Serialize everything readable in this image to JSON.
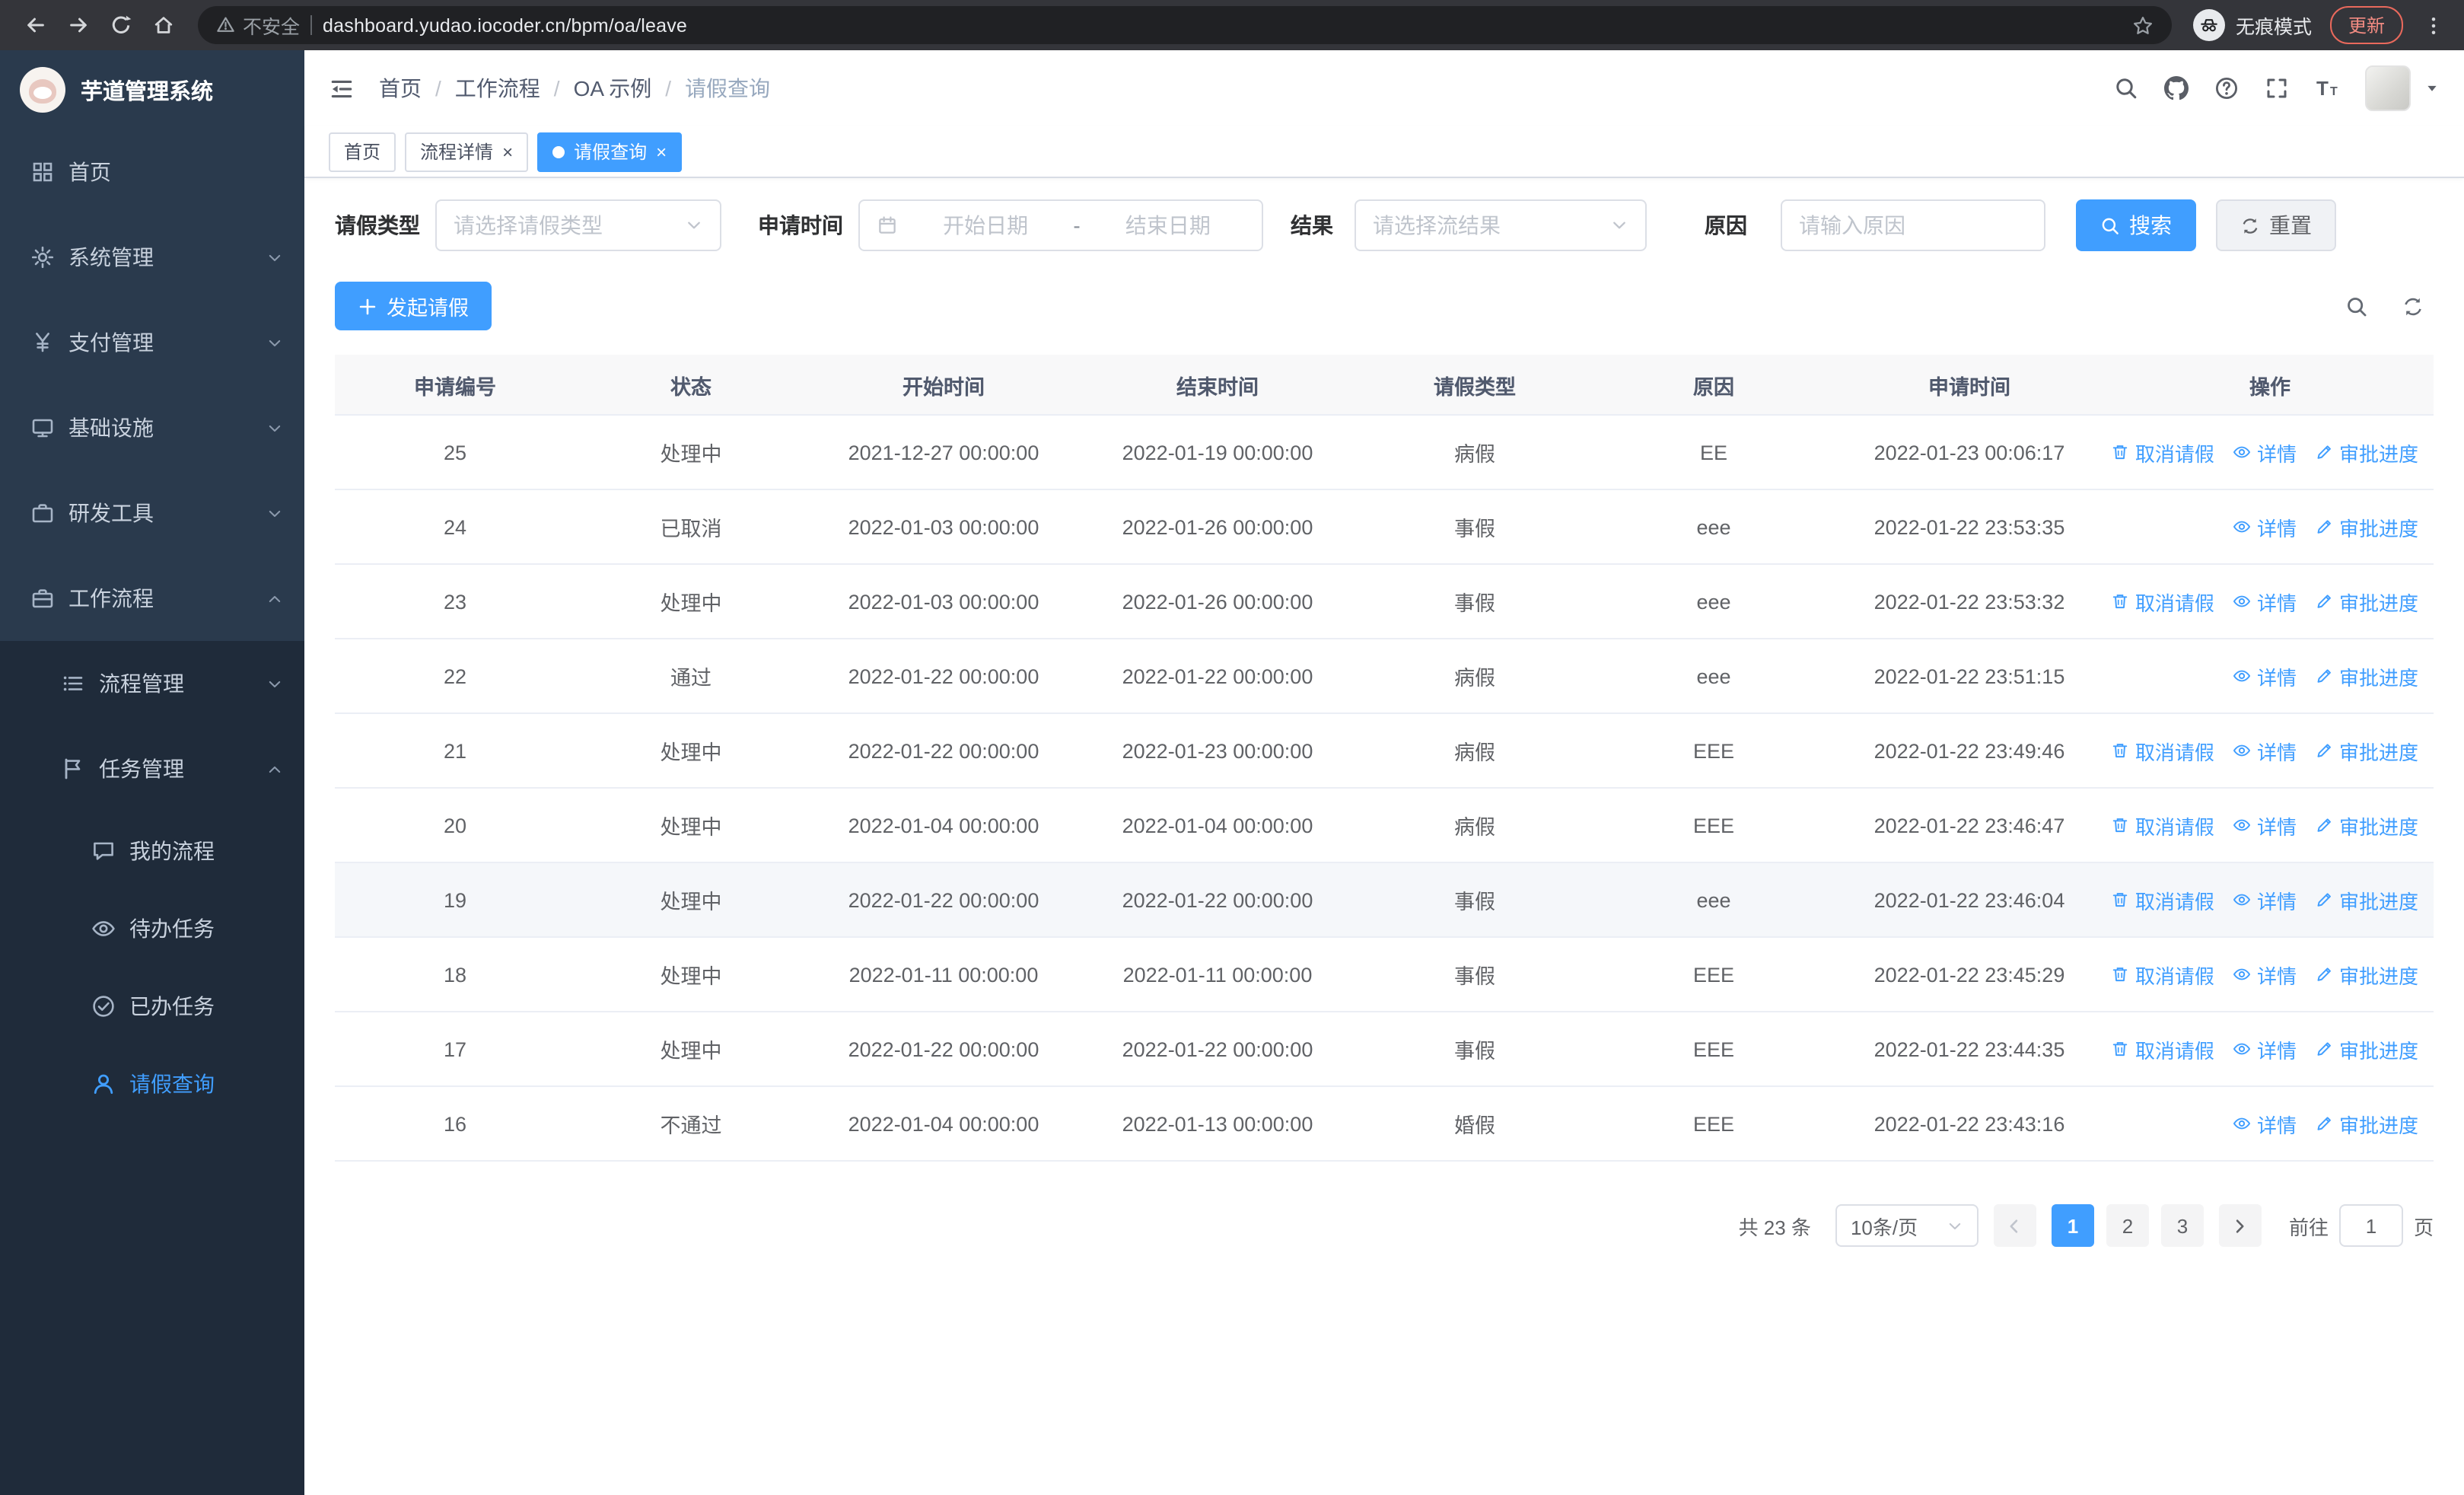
{
  "browser": {
    "security_warning": "不安全",
    "url": "dashboard.yudao.iocoder.cn/bpm/oa/leave",
    "incognito_label": "无痕模式",
    "update_label": "更新"
  },
  "sidebar": {
    "logo_title": "芋道管理系统",
    "menu": [
      {
        "name": "home",
        "label": "首页",
        "icon": "grid-icon",
        "level": 1,
        "chevron": null,
        "active": false
      },
      {
        "name": "system",
        "label": "系统管理",
        "icon": "gear-icon",
        "level": 1,
        "chevron": "down",
        "active": false
      },
      {
        "name": "payment",
        "label": "支付管理",
        "icon": "yen-icon",
        "level": 1,
        "chevron": "down",
        "active": false
      },
      {
        "name": "infrastructure",
        "label": "基础设施",
        "icon": "monitor-icon",
        "level": 1,
        "chevron": "down",
        "active": false
      },
      {
        "name": "dev-tools",
        "label": "研发工具",
        "icon": "briefcase-icon",
        "level": 1,
        "chevron": "down",
        "active": false
      },
      {
        "name": "workflow",
        "label": "工作流程",
        "icon": "suitcase-icon",
        "level": 1,
        "chevron": "up",
        "active": false
      },
      {
        "name": "process-mgmt",
        "label": "流程管理",
        "icon": "list-icon",
        "level": 2,
        "chevron": "down",
        "active": false
      },
      {
        "name": "task-mgmt",
        "label": "任务管理",
        "icon": "flag-icon",
        "level": 2,
        "chevron": "up",
        "active": false
      },
      {
        "name": "my-process",
        "label": "我的流程",
        "icon": "chat-icon",
        "level": 3,
        "chevron": null,
        "active": false
      },
      {
        "name": "todo-task",
        "label": "待办任务",
        "icon": "eye-icon",
        "level": 3,
        "chevron": null,
        "active": false
      },
      {
        "name": "done-task",
        "label": "已办任务",
        "icon": "check-circle-icon",
        "level": 3,
        "chevron": null,
        "active": false
      },
      {
        "name": "leave-query",
        "label": "请假查询",
        "icon": "user-icon",
        "level": 3,
        "chevron": null,
        "active": true
      }
    ]
  },
  "header": {
    "breadcrumb": [
      "首页",
      "工作流程",
      "OA 示例",
      "请假查询"
    ],
    "separator": "/"
  },
  "tabs": [
    {
      "label": "首页",
      "closable": false,
      "active": false
    },
    {
      "label": "流程详情",
      "closable": true,
      "active": false
    },
    {
      "label": "请假查询",
      "closable": true,
      "active": true
    }
  ],
  "filters": {
    "leave_type_label": "请假类型",
    "leave_type_placeholder": "请选择请假类型",
    "apply_time_label": "申请时间",
    "start_date_placeholder": "开始日期",
    "date_separator": "-",
    "end_date_placeholder": "结束日期",
    "result_label": "结果",
    "result_placeholder": "请选择流结果",
    "reason_label": "原因",
    "reason_placeholder": "请输入原因",
    "search_label": "搜索",
    "reset_label": "重置"
  },
  "toolbar": {
    "create_label": "发起请假"
  },
  "table": {
    "columns": [
      "申请编号",
      "状态",
      "开始时间",
      "结束时间",
      "请假类型",
      "原因",
      "申请时间",
      "操作"
    ],
    "actions": {
      "cancel": "取消请假",
      "detail": "详情",
      "progress": "审批进度"
    },
    "rows": [
      {
        "id": "25",
        "status": "处理中",
        "start": "2021-12-27 00:00:00",
        "end": "2022-01-19 00:00:00",
        "type": "病假",
        "reason": "EE",
        "apply_time": "2022-01-23 00:06:17",
        "cancelable": true,
        "highlight": false
      },
      {
        "id": "24",
        "status": "已取消",
        "start": "2022-01-03 00:00:00",
        "end": "2022-01-26 00:00:00",
        "type": "事假",
        "reason": "eee",
        "apply_time": "2022-01-22 23:53:35",
        "cancelable": false,
        "highlight": false
      },
      {
        "id": "23",
        "status": "处理中",
        "start": "2022-01-03 00:00:00",
        "end": "2022-01-26 00:00:00",
        "type": "事假",
        "reason": "eee",
        "apply_time": "2022-01-22 23:53:32",
        "cancelable": true,
        "highlight": false
      },
      {
        "id": "22",
        "status": "通过",
        "start": "2022-01-22 00:00:00",
        "end": "2022-01-22 00:00:00",
        "type": "病假",
        "reason": "eee",
        "apply_time": "2022-01-22 23:51:15",
        "cancelable": false,
        "highlight": false
      },
      {
        "id": "21",
        "status": "处理中",
        "start": "2022-01-22 00:00:00",
        "end": "2022-01-23 00:00:00",
        "type": "病假",
        "reason": "EEE",
        "apply_time": "2022-01-22 23:49:46",
        "cancelable": true,
        "highlight": false
      },
      {
        "id": "20",
        "status": "处理中",
        "start": "2022-01-04 00:00:00",
        "end": "2022-01-04 00:00:00",
        "type": "病假",
        "reason": "EEE",
        "apply_time": "2022-01-22 23:46:47",
        "cancelable": true,
        "highlight": false
      },
      {
        "id": "19",
        "status": "处理中",
        "start": "2022-01-22 00:00:00",
        "end": "2022-01-22 00:00:00",
        "type": "事假",
        "reason": "eee",
        "apply_time": "2022-01-22 23:46:04",
        "cancelable": true,
        "highlight": true
      },
      {
        "id": "18",
        "status": "处理中",
        "start": "2022-01-11 00:00:00",
        "end": "2022-01-11 00:00:00",
        "type": "事假",
        "reason": "EEE",
        "apply_time": "2022-01-22 23:45:29",
        "cancelable": true,
        "highlight": false
      },
      {
        "id": "17",
        "status": "处理中",
        "start": "2022-01-22 00:00:00",
        "end": "2022-01-22 00:00:00",
        "type": "事假",
        "reason": "EEE",
        "apply_time": "2022-01-22 23:44:35",
        "cancelable": true,
        "highlight": false
      },
      {
        "id": "16",
        "status": "不通过",
        "start": "2022-01-04 00:00:00",
        "end": "2022-01-13 00:00:00",
        "type": "婚假",
        "reason": "EEE",
        "apply_time": "2022-01-22 23:43:16",
        "cancelable": false,
        "highlight": false
      }
    ]
  },
  "pagination": {
    "total_text": "共 23 条",
    "page_size": "10条/页",
    "pages": [
      "1",
      "2",
      "3"
    ],
    "active_page": "1",
    "goto_label": "前往",
    "goto_value": "1",
    "goto_suffix": "页"
  },
  "colors": {
    "primary": "#409eff",
    "sidebar_bg": "#1f2b3a",
    "sidebar_item_bg": "#2a3a4d",
    "active_tab_bg": "#409eff"
  }
}
